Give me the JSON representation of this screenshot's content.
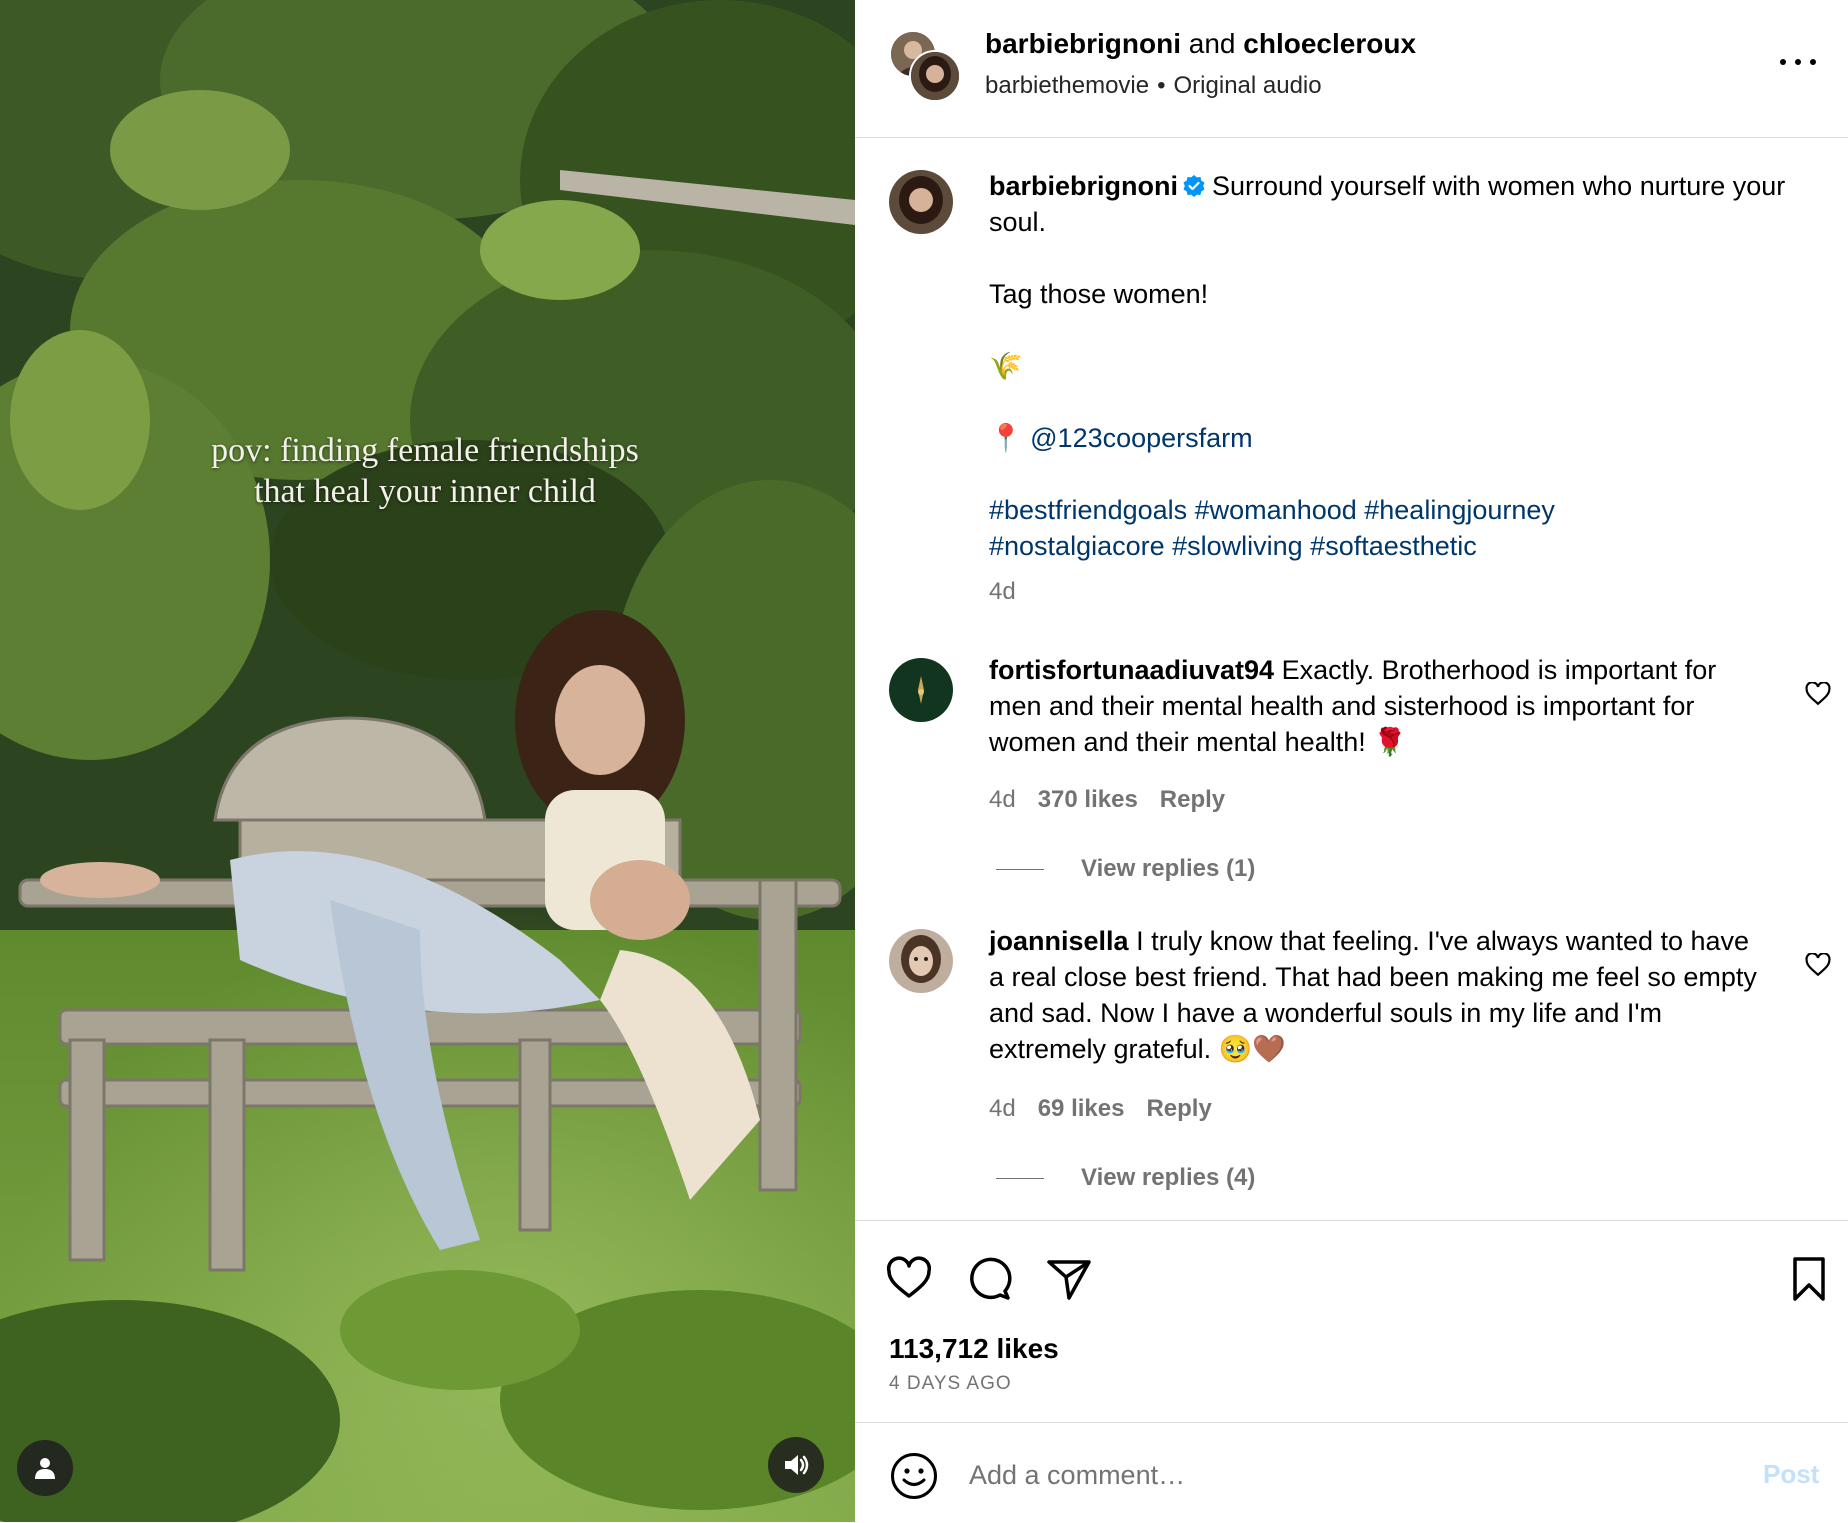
{
  "media": {
    "overlay_text_line1": "pov: finding female friendships",
    "overlay_text_line2": "that heal your inner child"
  },
  "header": {
    "user1": "barbiebrignoni",
    "and_text": "and",
    "user2": "chloecleroux",
    "account": "barbiethemovie",
    "separator": "•",
    "audio": "Original audio"
  },
  "caption": {
    "username": "barbiebrignoni",
    "text": "Surround yourself with women who nurture your soul.",
    "line2": "Tag those women!",
    "emoji": "🌾",
    "pin": "📍",
    "mention": "@123coopersfarm",
    "hashtags_line1": "#bestfriendgoals #womanhood #healingjourney",
    "hashtags_line2": "#nostalgiacore #slowliving #softaesthetic",
    "time": "4d"
  },
  "comments": [
    {
      "username": "fortisfortunaadiuvat94",
      "text": "Exactly. Brotherhood is important for men and their mental health and sisterhood is important for women and their mental health! 🌹",
      "time": "4d",
      "likes": "370 likes",
      "reply": "Reply",
      "view_replies": "View replies (1)"
    },
    {
      "username": "joannisella",
      "text": "I truly know that feeling. I've always wanted to have a real close best friend. That had been making me feel so empty and sad. Now I have a wonderful souls in my life and I'm extremely grateful. 🥹🤎",
      "time": "4d",
      "likes": "69 likes",
      "reply": "Reply",
      "view_replies": "View replies (4)"
    }
  ],
  "post": {
    "likes": "113,712 likes",
    "date": "4 DAYS AGO"
  },
  "add_comment": {
    "placeholder": "Add a comment…",
    "post_label": "Post"
  },
  "colors": {
    "link": "#00376b",
    "secondary_text": "#737373",
    "divider": "#dbdbdb",
    "post_disabled": "#c3e1fd",
    "verified": "#0095f6"
  },
  "icons": [
    "user-tag-icon",
    "audio-icon",
    "more-icon",
    "verified-icon",
    "heart-icon",
    "comment-icon",
    "share-icon",
    "bookmark-icon",
    "emoji-icon"
  ]
}
